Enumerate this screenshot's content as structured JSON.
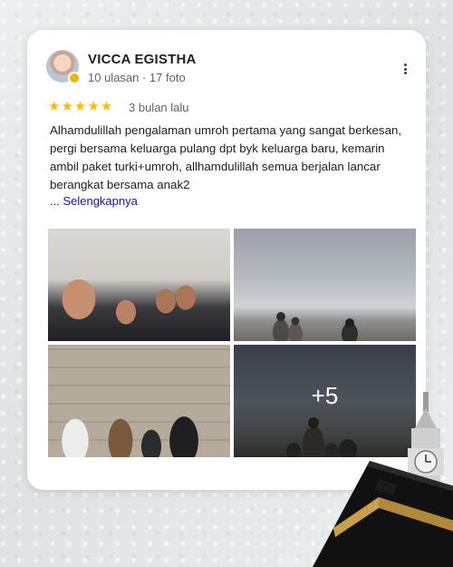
{
  "reviewer": {
    "name": "VICCA EGISTHA",
    "meta": "10 ulasan · 17 foto"
  },
  "rating": {
    "stars": 5,
    "time": "3 bulan lalu"
  },
  "review": {
    "text": "Alhamdulillah pengalaman umroh pertama yang sangat berkesan, pergi bersama keluarga pulang dpt byk keluarga baru, kemarin ambil paket turki+umroh, allhamdulillah semua berjalan lancar berangkat bersama anak2",
    "more_link": "... Selengkapnya"
  },
  "photos": {
    "more_count": "+5"
  },
  "colors": {
    "star": "#fbbc04",
    "link": "#1a0dab",
    "card_bg": "#ffffff",
    "page_bg": "#e9eaec"
  },
  "icons": {
    "more": "more-vertical-icon",
    "star": "star-icon"
  }
}
